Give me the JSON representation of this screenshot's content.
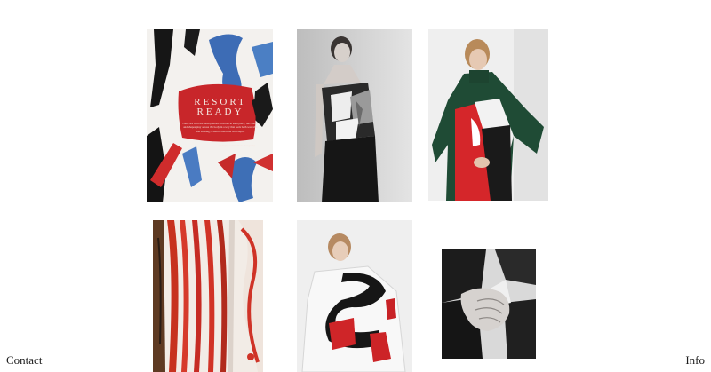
{
  "nav": {
    "contact_label": "Contact",
    "info_label": "Info"
  },
  "gallery": {
    "magazine": {
      "title_line1": "RESORT",
      "title_line2": "READY",
      "body_text": "There are intricate hand-painted artworks in each piece; the colours and shapes play across the body in a way that feels both wearable and striking, a resort collection with depth.",
      "credit_text": "Styling by Gemma Deeks Photography"
    }
  },
  "colors": {
    "background": "#ffffff",
    "text": "#1b1b1b",
    "accent_red": "#c8262a",
    "accent_blue": "#3e6fb6",
    "accent_green": "#1d4a33"
  }
}
